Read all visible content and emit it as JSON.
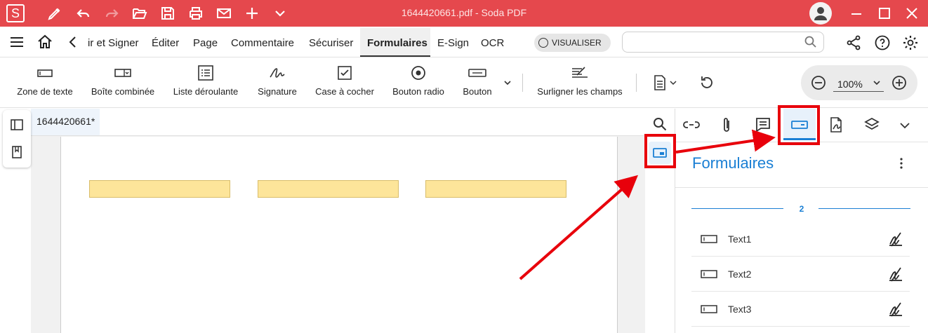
{
  "app": {
    "title": "1644420661.pdf  -  Soda PDF",
    "logo_letter": "S"
  },
  "titlebar_icons": [
    "pen-icon",
    "undo-icon",
    "redo-icon",
    "folder-open-icon",
    "save-icon",
    "print-icon",
    "mail-icon",
    "plus-icon",
    "chevron-down-icon",
    "user-avatar-icon",
    "minimize-icon",
    "maximize-icon",
    "close-icon"
  ],
  "menu": {
    "items": [
      "ir et Signer",
      "Éditer",
      "Page",
      "Commentaire",
      "Sécuriser",
      "Formulaires",
      "E-Sign",
      "OCR"
    ],
    "active": "Formulaires",
    "view_toggle": "VISUALISER",
    "search_placeholder": ""
  },
  "ribbon": {
    "tools": [
      "Zone de texte",
      "Boîte combinée",
      "Liste déroulante",
      "Signature",
      "Case à cocher",
      "Bouton radio",
      "Bouton",
      "Surligner les champs"
    ],
    "zoom": "100%"
  },
  "document": {
    "tab_name": "1644420661*",
    "field_count_visible": 3
  },
  "side_panel": {
    "title": "Formulaires",
    "page_label": "2",
    "fields": [
      {
        "name": "Text1"
      },
      {
        "name": "Text2"
      },
      {
        "name": "Text3"
      }
    ]
  },
  "colors": {
    "brand": "#e5484d",
    "accent_blue": "#1a7fd4",
    "field_fill": "#fde59a",
    "annotation_red": "#e8000b"
  }
}
